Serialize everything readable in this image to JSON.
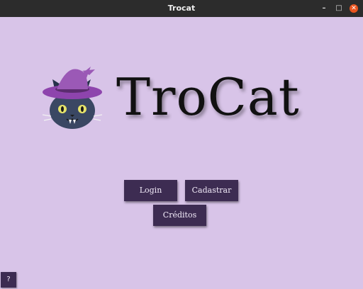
{
  "window": {
    "title": "Trocat",
    "controls": {
      "minimize": "–",
      "maximize": "□",
      "close": "✕"
    }
  },
  "logo": {
    "text": "TroCat",
    "icon": "wizard-cat-icon"
  },
  "buttons": {
    "login": "Login",
    "register": "Cadastrar",
    "credits": "Créditos"
  },
  "help": {
    "label": "?"
  },
  "colors": {
    "background": "#d8c4e8",
    "button": "#3d2c52",
    "titlebar": "#2c2c2c",
    "close": "#e9541f"
  }
}
